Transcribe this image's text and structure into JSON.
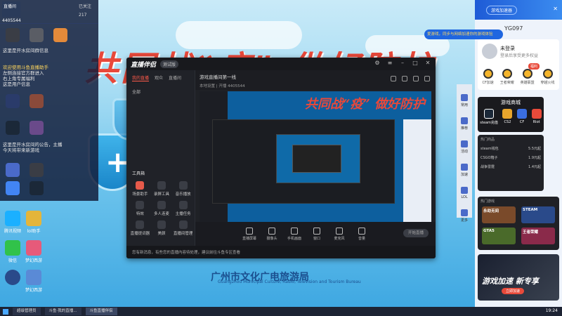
{
  "desktop": {
    "banner": "共同战“疫” 做好防护",
    "bureau": "广州市文化广电旅游局",
    "bureau_en": "Guangzhou Municipal Culture, Radio, Television and Tourism Bureau",
    "icons": [
      {
        "label": "腾讯视频",
        "color": "#1bb0ff"
      },
      {
        "label": "lol助手",
        "color": "#e4b53a"
      },
      {
        "label": "微信",
        "color": "#31c24a"
      },
      {
        "label": "梦幻西游",
        "color": "#e65a7a"
      },
      {
        "label": "",
        "color": "#2a4a8a"
      },
      {
        "label": "梦幻西游",
        "color": "#5a8ad6"
      }
    ]
  },
  "chat": {
    "user_id": "4405544",
    "room_label": "直播间",
    "subscribe": "已关注",
    "count": "217",
    "msgs": [
      {
        "text": "这里是开水房间群信息",
        "hl": false
      },
      {
        "text": "欢迎使用斗鱼直播助手",
        "hl": true
      },
      {
        "text": "左侧连接官方群进入",
        "hl": false
      },
      {
        "text": "右上角专属福利",
        "hl": false
      },
      {
        "text": "这是用户信息",
        "hl": false
      },
      {
        "text": "这里是开水房间的公告，主播",
        "hl": false
      },
      {
        "text": "今天将带来新游戏",
        "hl": false
      }
    ]
  },
  "window": {
    "logo": "直播伴侣",
    "logo_badge": "测试版",
    "side_tabs": [
      "我的直播",
      "观众",
      "直播间"
    ],
    "side_row": "全部",
    "tool_title": "工具箱",
    "tools": [
      {
        "label": "场景助手",
        "red": true
      },
      {
        "label": "录屏工具",
        "red": false
      },
      {
        "label": "音乐播放",
        "red": false
      },
      {
        "label": "特效",
        "red": false
      },
      {
        "label": "多人连麦",
        "red": false
      },
      {
        "label": "主播任务",
        "red": false
      },
      {
        "label": "直播提词器",
        "red": false
      },
      {
        "label": "美颜",
        "red": false
      },
      {
        "label": "直播间管理",
        "red": false
      }
    ],
    "room_title": "游戏直播间第一线",
    "room_meta": "本地设置 | 开播  4405544",
    "bottom_items": [
      "直播屏幕",
      "摄像头",
      "手机画面",
      "窗口",
      "麦克风",
      "音量"
    ],
    "start_label": "开始直播",
    "footer": "您有新消息，有些您的直播内容待处理，建议前往斗鱼专区查看",
    "preview_banner": "共同战“疫” 做好防护"
  },
  "right_panel": {
    "header_btn": "游戏加速器",
    "notice": "爱游戏，同步与网络加速你的游戏体验",
    "code": "YG097",
    "user_name": "未登录",
    "user_vip": "登录后享受更多权益",
    "badge": "福利",
    "feats": [
      "CF加速",
      "王者荣耀",
      "英雄联盟",
      "穿越火线"
    ],
    "store_title": "游戏商城",
    "store_items": [
      {
        "label": "steam充值",
        "color": "#1b2838"
      },
      {
        "label": "CS2",
        "color": "#e8a52c"
      },
      {
        "label": "CF",
        "color": "#3a6ee0"
      },
      {
        "label": "Riot",
        "color": "#e84a3a"
      }
    ],
    "list_title": "热门商品",
    "list_rows": [
      {
        "name": "steam钱包",
        "price": "5.5元起"
      },
      {
        "name": "CSGO箱子",
        "price": "1.9元起"
      },
      {
        "name": "战争雷霆",
        "price": "1.4元起"
      }
    ],
    "tiles_title": "热门游戏",
    "tiles": [
      {
        "label": "永劫无间",
        "color": "#7a4a2a"
      },
      {
        "label": "STEAM",
        "color": "#2a4a8a"
      },
      {
        "label": "GTA5",
        "color": "#4a6a2a"
      },
      {
        "label": "王者荣耀",
        "color": "#8a2a4a"
      }
    ],
    "promo_text": "游戏加速 新专享",
    "promo_btn": "立即加速"
  },
  "sidebar": {
    "items": [
      "常用",
      "推荐",
      "活动",
      "加速",
      "LOL",
      "更多"
    ]
  },
  "taskbar": {
    "items": [
      "超级管理员",
      "斗鱼·我的直播...",
      "斗鱼直播伴侣"
    ],
    "clock": "19:24"
  },
  "colors": {
    "accent": "#e8483a",
    "window_bg": "#1f2126",
    "panel_blue": "#1e5bd6"
  }
}
